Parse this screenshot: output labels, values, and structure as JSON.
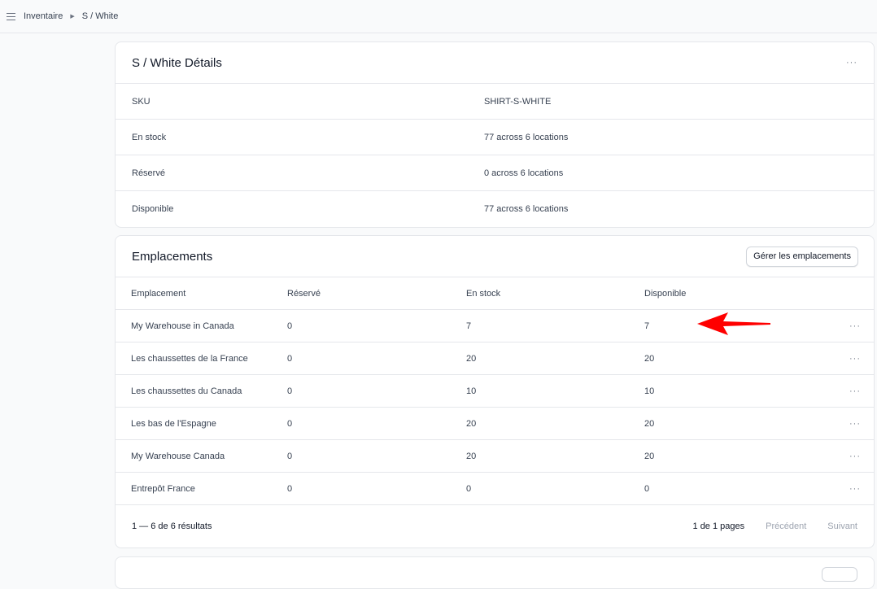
{
  "breadcrumb": {
    "root": "Inventaire",
    "current": "S / White"
  },
  "details": {
    "title": "S / White Détails",
    "more": "···",
    "rows": [
      {
        "label": "SKU",
        "value": "SHIRT-S-WHITE"
      },
      {
        "label": "En stock",
        "value": "77 across 6 locations"
      },
      {
        "label": "Réservé",
        "value": "0 across 6 locations"
      },
      {
        "label": "Disponible",
        "value": "77 across 6 locations"
      }
    ]
  },
  "locations": {
    "title": "Emplacements",
    "manage_button": "Gérer les emplacements",
    "columns": [
      "Emplacement",
      "Réservé",
      "En stock",
      "Disponible"
    ],
    "rows": [
      {
        "name": "My Warehouse in Canada",
        "reserved": "0",
        "stock": "7",
        "available": "7",
        "more": "···"
      },
      {
        "name": "Les chaussettes de la France",
        "reserved": "0",
        "stock": "20",
        "available": "20",
        "more": "···"
      },
      {
        "name": "Les chaussettes du Canada",
        "reserved": "0",
        "stock": "10",
        "available": "10",
        "more": "···"
      },
      {
        "name": "Les bas de l'Espagne",
        "reserved": "0",
        "stock": "20",
        "available": "20",
        "more": "···"
      },
      {
        "name": "My Warehouse Canada",
        "reserved": "0",
        "stock": "20",
        "available": "20",
        "more": "···"
      },
      {
        "name": "Entrepôt France",
        "reserved": "0",
        "stock": "0",
        "available": "0",
        "more": "···"
      }
    ],
    "pagination": {
      "results": "1 — 6 de 6 résultats",
      "pages": "1 de 1 pages",
      "prev": "Précédent",
      "next": "Suivant"
    }
  },
  "annotation": {
    "arrow_color": "#ff0000"
  }
}
